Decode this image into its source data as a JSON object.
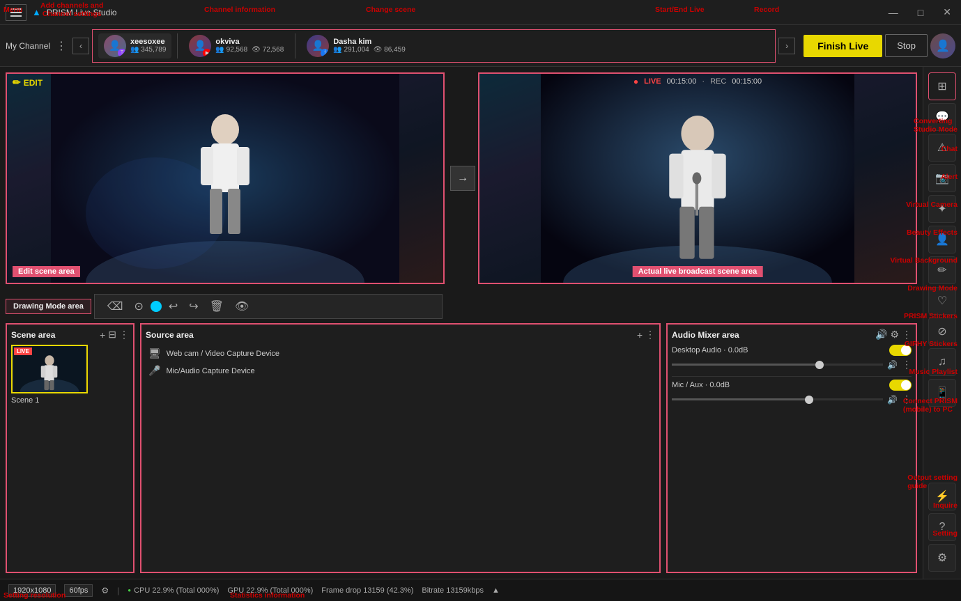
{
  "app": {
    "title": "PRISM Live Studio",
    "logo": "PRISM"
  },
  "titlebar": {
    "title": "PRISM Live Studio",
    "minimize": "—",
    "maximize": "□",
    "close": "✕"
  },
  "header": {
    "my_channel": "My Channel",
    "finish_live": "Finish Live",
    "stop": "Stop",
    "record": "Record"
  },
  "channels": [
    {
      "name": "xeesoxee",
      "platform": "twitch",
      "followers": "345,789",
      "platform_icon": "T"
    },
    {
      "name": "okviva",
      "platform": "youtube",
      "followers": "92,568",
      "views": "72,568",
      "platform_icon": "▶"
    },
    {
      "name": "Dasha kim",
      "platform": "facebook",
      "followers": "291,004",
      "views": "86,459",
      "platform_icon": "f"
    }
  ],
  "edit_panel": {
    "label": "EDIT",
    "area_label": "Edit scene area"
  },
  "live_panel": {
    "live_label": "LIVE",
    "live_timer": "00:15:00",
    "rec_label": "REC",
    "rec_timer": "00:15:00",
    "area_label": "Actual live broadcast scene area"
  },
  "drawing_mode": {
    "label": "Drawing Mode area"
  },
  "scene_area": {
    "title": "Scene area",
    "scene_name": "Scene 1"
  },
  "source_area": {
    "title": "Source area",
    "sources": [
      {
        "icon": "🖥",
        "name": "Web cam / Video Capture Device"
      },
      {
        "icon": "🎤",
        "name": "Mic/Audio Capture Device"
      }
    ]
  },
  "audio_mixer": {
    "title": "Audio Mixer area",
    "channels": [
      {
        "name": "Desktop Audio · 0.0dB",
        "enabled": true
      },
      {
        "name": "Mic / Aux · 0.0dB",
        "enabled": true
      }
    ]
  },
  "right_panel": {
    "items": [
      {
        "id": "converting",
        "icon": "⊞",
        "label": "Converting Studio Mode"
      },
      {
        "id": "chat",
        "icon": "💬",
        "label": "Chat"
      },
      {
        "id": "alert",
        "icon": "⚠",
        "label": "Alert"
      },
      {
        "id": "virtual-camera",
        "icon": "📷",
        "label": "Virtual Camera"
      },
      {
        "id": "beauty-effects",
        "icon": "✦",
        "label": "Beauty Effects"
      },
      {
        "id": "virtual-background",
        "icon": "👤",
        "label": "Virtual Background"
      },
      {
        "id": "drawing-mode",
        "icon": "✏",
        "label": "Drawing Mode"
      },
      {
        "id": "prism-stickers",
        "icon": "♡",
        "label": "PRISM Stickers"
      },
      {
        "id": "giphy-stickers",
        "icon": "⊘",
        "label": "GIPHY Stickers"
      },
      {
        "id": "music-playlist",
        "icon": "♫",
        "label": "Music Playlist"
      },
      {
        "id": "connect-prism",
        "icon": "📱",
        "label": "Connect PRISM (mobile) to PC"
      },
      {
        "id": "output-setting",
        "icon": "⚡",
        "label": "Output setting guide"
      },
      {
        "id": "inquire",
        "icon": "?",
        "label": "Inquire"
      },
      {
        "id": "setting",
        "icon": "⚙",
        "label": "Setting"
      }
    ]
  },
  "annotations": {
    "menu": "Menu",
    "add_channels": "Add channels and\nChannel settings",
    "channel_info": "Channel information",
    "change_scene": "Change scene",
    "start_end_live": "Start/End Live",
    "record": "Record",
    "finish_live_ann": "Finish Live",
    "converting_studio": "Converting\nStudio Mode",
    "chat": "Chat",
    "alert": "Alert",
    "virtual_camera": "Virtual Camera",
    "beauty_effects": "Beauty Effects",
    "virtual_background": "Virtual Background",
    "drawing_mode_ann": "Drawing Mode",
    "prism_stickers": "PRISM Stickers",
    "giphy_stickers": "GIPHY Stickers",
    "music_playlist": "Music Playlist",
    "connect_prism": "Connect PRISM\n(mobile) to PC",
    "output_setting": "Output setting\nguide",
    "inquire": "Inquire",
    "setting": "Setting",
    "setting_resolution": "Setting resolution",
    "statistics_info": "Statistics information",
    "source_area": "Source area"
  },
  "status_bar": {
    "resolution": "1920x1080",
    "fps": "60fps",
    "cpu": "CPU 22.9% (Total 000%)",
    "gpu": "GPU 22.9% (Total 000%)",
    "frame_drop": "Frame drop 13159 (42.3%)",
    "bitrate": "Bitrate 13159kbps"
  }
}
